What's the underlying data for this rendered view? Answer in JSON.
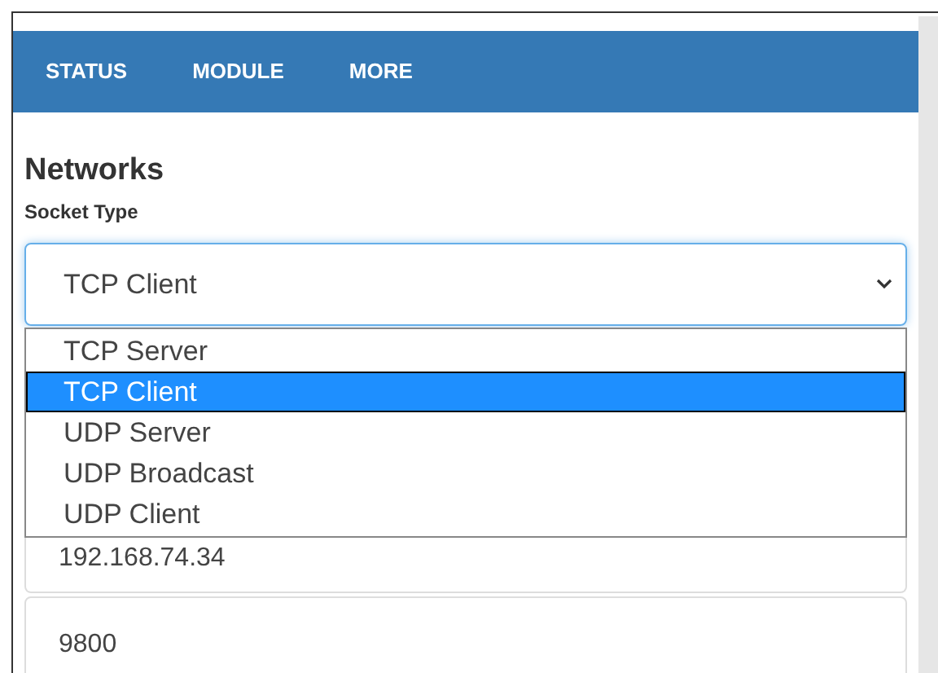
{
  "nav": {
    "items": [
      {
        "label": "STATUS"
      },
      {
        "label": "MODULE"
      },
      {
        "label": "MORE"
      }
    ]
  },
  "heading": "Networks",
  "socket_type": {
    "label": "Socket Type",
    "value": "TCP Client",
    "expanded": true,
    "options": [
      {
        "label": "TCP Server",
        "selected": false
      },
      {
        "label": "TCP Client",
        "selected": true
      },
      {
        "label": "UDP Server",
        "selected": false
      },
      {
        "label": "UDP Broadcast",
        "selected": false
      },
      {
        "label": "UDP Client",
        "selected": false
      }
    ]
  },
  "fields": [
    {
      "value": "192.168.74.34"
    },
    {
      "value": "9800"
    }
  ]
}
